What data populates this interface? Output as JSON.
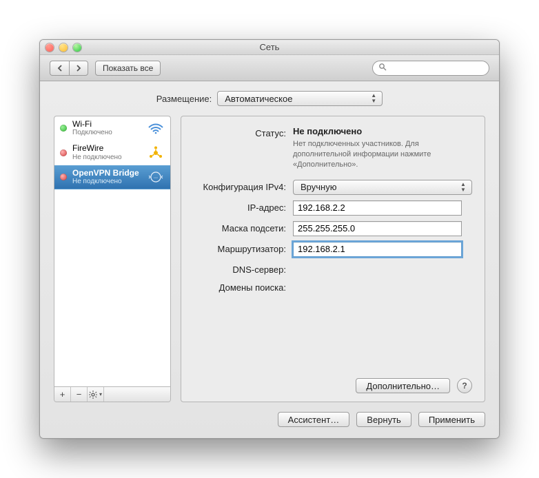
{
  "window": {
    "title": "Сеть"
  },
  "toolbar": {
    "show_all": "Показать все",
    "search_placeholder": ""
  },
  "location": {
    "label": "Размещение:",
    "value": "Автоматическое"
  },
  "sidebar": {
    "items": [
      {
        "name": "Wi-Fi",
        "status_text": "Подключено",
        "status": "green",
        "icon": "wifi"
      },
      {
        "name": "FireWire",
        "status_text": "Не подключено",
        "status": "red",
        "icon": "firewire"
      },
      {
        "name": "OpenVPN Bridge",
        "status_text": "Не подключено",
        "status": "red",
        "icon": "vpn",
        "selected": true
      }
    ]
  },
  "details": {
    "status_label": "Статус:",
    "status_value": "Не подключено",
    "status_sub": "Нет подключенных участников. Для дополнительной информации нажмите «Дополнительно».",
    "ipv4_label": "Конфигурация IPv4:",
    "ipv4_value": "Вручную",
    "ip_label": "IP-адрес:",
    "ip_value": "192.168.2.2",
    "mask_label": "Маска подсети:",
    "mask_value": "255.255.255.0",
    "router_label": "Маршрутизатор:",
    "router_value": "192.168.2.1",
    "dns_label": "DNS-сервер:",
    "dns_value": "",
    "search_domains_label": "Домены поиска:",
    "search_domains_value": "",
    "advanced": "Дополнительно…"
  },
  "buttons": {
    "assistant": "Ассистент…",
    "revert": "Вернуть",
    "apply": "Применить"
  }
}
